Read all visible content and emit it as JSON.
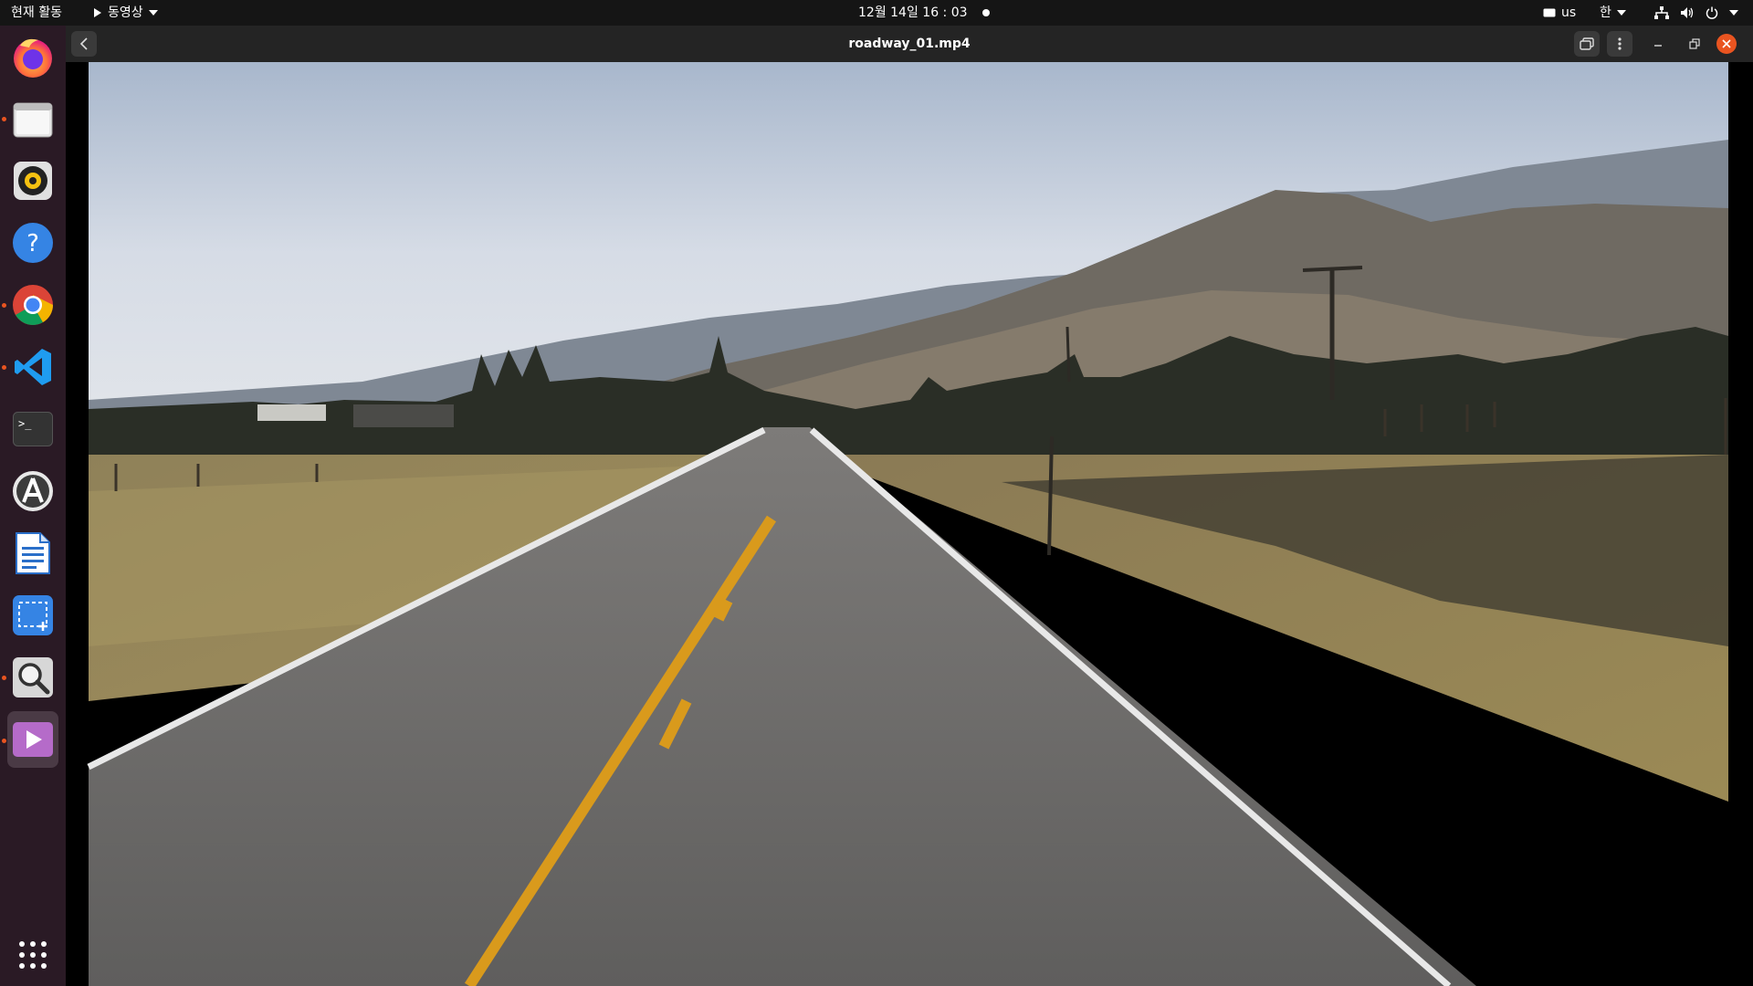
{
  "topbar": {
    "activities": "현재 활동",
    "app_menu": "동영상",
    "clock": "12월 14일  16 : 03",
    "keyboard_layout": "us",
    "input_method": "한"
  },
  "dock": {
    "apps": [
      {
        "name": "firefox-icon",
        "running": false
      },
      {
        "name": "files-icon",
        "running": true
      },
      {
        "name": "rhythmbox-icon",
        "running": false
      },
      {
        "name": "help-icon",
        "running": false
      },
      {
        "name": "chrome-icon",
        "running": true
      },
      {
        "name": "vscode-icon",
        "running": true
      },
      {
        "name": "terminal-icon",
        "running": false
      },
      {
        "name": "software-icon",
        "running": false
      },
      {
        "name": "writer-icon",
        "running": false
      },
      {
        "name": "screenshot-icon",
        "running": false
      },
      {
        "name": "search-icon",
        "running": true
      },
      {
        "name": "videos-icon",
        "running": true
      }
    ]
  },
  "window": {
    "title": "roadway_01.mp4"
  },
  "colors": {
    "accent": "#e95420",
    "close_button": "#e95420",
    "dock_bg": "#2a1a25"
  }
}
